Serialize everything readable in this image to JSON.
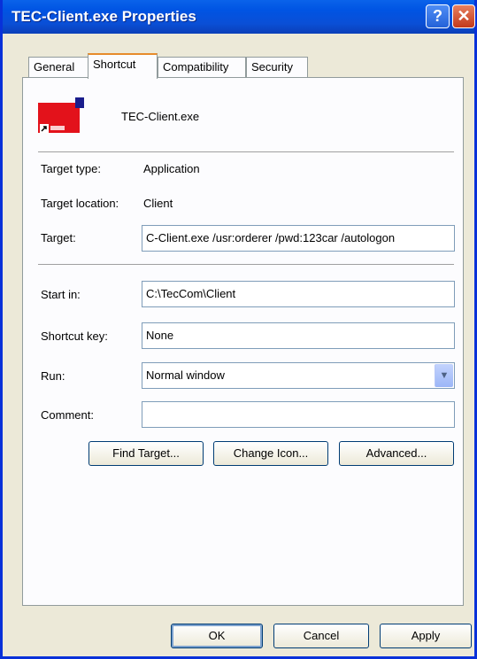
{
  "window": {
    "title": "TEC-Client.exe Properties",
    "help_label": "?",
    "close_label": "✕"
  },
  "tabs": [
    {
      "label": "General"
    },
    {
      "label": "Shortcut"
    },
    {
      "label": "Compatibility"
    },
    {
      "label": "Security"
    }
  ],
  "file": {
    "name": "TEC-Client.exe"
  },
  "fields": {
    "target_type_label": "Target type:",
    "target_type_value": "Application",
    "target_location_label": "Target location:",
    "target_location_value": "Client",
    "target_label": "Target:",
    "target_value": "C-Client.exe /usr:orderer /pwd:123car /autologon",
    "start_in_label": "Start in:",
    "start_in_value": "C:\\TecCom\\Client",
    "shortcut_key_label": "Shortcut key:",
    "shortcut_key_value": "None",
    "run_label": "Run:",
    "run_value": "Normal window",
    "comment_label": "Comment:",
    "comment_value": ""
  },
  "buttons": {
    "find_target": "Find Target...",
    "change_icon": "Change Icon...",
    "advanced": "Advanced...",
    "ok": "OK",
    "cancel": "Cancel",
    "apply": "Apply"
  },
  "colors": {
    "titlebar": "#0054e3",
    "dialog_bg": "#ece9d8",
    "tab_highlight": "#e68b2c",
    "icon_red": "#e3121b",
    "icon_blue": "#1a1d8c"
  }
}
